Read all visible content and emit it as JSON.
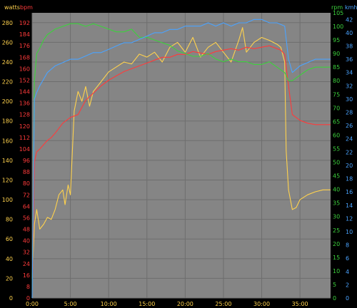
{
  "chart_data": {
    "type": "line",
    "title": "",
    "xlabel": "",
    "x_ticks": [
      "0:00",
      "5:00",
      "10:00",
      "15:00",
      "20:00",
      "25:00",
      "30:00",
      "35:00"
    ],
    "x_range_minutes": [
      0,
      39
    ],
    "grid": true,
    "axes": {
      "watts": {
        "label": "watts",
        "color": "#ffd24d",
        "range": [
          0,
          290
        ],
        "ticks": [
          0,
          20,
          40,
          60,
          80,
          100,
          120,
          140,
          160,
          180,
          200,
          220,
          240,
          260,
          280
        ]
      },
      "bpm": {
        "label": "bpm",
        "color": "#ff3b3b",
        "range": [
          0,
          199
        ],
        "ticks": [
          0,
          8,
          16,
          24,
          32,
          40,
          48,
          56,
          64,
          72,
          80,
          88,
          96,
          104,
          112,
          120,
          128,
          136,
          144,
          152,
          160,
          168,
          176,
          184,
          192
        ]
      },
      "rpm": {
        "label": "rpm",
        "color": "#3cd23c",
        "range": [
          0,
          105
        ],
        "ticks": [
          0,
          5,
          10,
          15,
          20,
          25,
          30,
          35,
          40,
          45,
          50,
          55,
          60,
          65,
          70,
          75,
          80,
          85,
          90,
          95,
          100,
          105
        ]
      },
      "kmh": {
        "label": "kmh",
        "color": "#4aa3ff",
        "range": [
          0,
          43
        ],
        "ticks": [
          0,
          2,
          4,
          6,
          8,
          10,
          12,
          14,
          16,
          18,
          20,
          22,
          24,
          26,
          28,
          30,
          32,
          34,
          36,
          38,
          40,
          42
        ]
      }
    },
    "series": [
      {
        "axis": "watts",
        "color": "#ffd24d",
        "x": [
          0,
          0.3,
          0.6,
          1,
          1.5,
          2,
          2.5,
          3,
          3.5,
          4,
          4.3,
          4.7,
          5,
          5.5,
          6,
          6.5,
          7,
          7.5,
          8,
          9,
          10,
          11,
          12,
          13,
          14,
          15,
          16,
          17,
          18,
          19,
          20,
          21,
          22,
          23,
          24,
          25,
          26,
          27,
          27.5,
          28,
          28.5,
          29,
          30,
          31,
          32,
          32.5,
          33,
          33.2,
          33.5,
          34,
          34.5,
          35,
          36,
          37,
          38,
          39
        ],
        "y": [
          20,
          75,
          90,
          70,
          75,
          82,
          80,
          90,
          105,
          110,
          95,
          115,
          105,
          190,
          210,
          200,
          215,
          195,
          210,
          220,
          230,
          235,
          240,
          238,
          248,
          245,
          250,
          240,
          255,
          260,
          250,
          265,
          245,
          255,
          260,
          250,
          240,
          262,
          275,
          250,
          255,
          260,
          265,
          262,
          258,
          255,
          240,
          150,
          110,
          90,
          92,
          100,
          105,
          108,
          110,
          110
        ]
      },
      {
        "axis": "bpm",
        "color": "#ff3b3b",
        "x": [
          0,
          0.3,
          0.6,
          1,
          1.5,
          2,
          2.5,
          3,
          4,
          5,
          6,
          7,
          8,
          9,
          10,
          11,
          12,
          13,
          14,
          15,
          16,
          17,
          18,
          19,
          20,
          21,
          22,
          23,
          24,
          25,
          26,
          27,
          28,
          29,
          30,
          31,
          32,
          32.5,
          33,
          33.5,
          34,
          35,
          36,
          37,
          38,
          39
        ],
        "y": [
          0,
          95,
          102,
          104,
          107,
          110,
          112,
          115,
          122,
          126,
          128,
          138,
          143,
          148,
          152,
          155,
          158,
          160,
          162,
          164,
          166,
          168,
          168,
          170,
          170,
          172,
          171,
          170,
          172,
          173,
          174,
          173,
          175,
          174,
          175,
          176,
          174,
          173,
          170,
          148,
          128,
          124,
          122,
          121,
          121,
          121
        ]
      },
      {
        "axis": "rpm",
        "color": "#3cd23c",
        "x": [
          0,
          0.3,
          0.6,
          1,
          1.5,
          2,
          3,
          4,
          5,
          6,
          7,
          8,
          9,
          10,
          11,
          12,
          13,
          14,
          15,
          16,
          17,
          18,
          19,
          20,
          21,
          22,
          23,
          24,
          25,
          26,
          27,
          28,
          29,
          30,
          31,
          32,
          33,
          33.5,
          34,
          35,
          36,
          37,
          38,
          39
        ],
        "y": [
          0,
          80,
          90,
          92,
          95,
          97,
          99,
          100,
          101,
          101,
          100,
          101,
          100,
          99,
          98,
          98,
          99,
          96,
          96,
          95,
          94,
          93,
          91,
          90,
          89,
          89,
          90,
          88,
          87,
          88,
          87,
          87,
          86,
          86,
          87,
          85,
          83,
          80,
          80,
          82,
          84,
          85,
          85,
          85
        ]
      },
      {
        "axis": "kmh",
        "color": "#4aa3ff",
        "x": [
          0,
          0.3,
          0.6,
          1,
          1.5,
          2,
          3,
          4,
          5,
          6,
          7,
          8,
          9,
          10,
          11,
          12,
          13,
          14,
          15,
          16,
          17,
          18,
          19,
          20,
          21,
          22,
          23,
          24,
          25,
          26,
          27,
          28,
          29,
          30,
          31,
          32,
          33,
          33.5,
          34,
          35,
          36,
          37,
          38,
          39
        ],
        "y": [
          0,
          30,
          31,
          32,
          33,
          34,
          35,
          35.5,
          36,
          36,
          36.5,
          37,
          37,
          37.5,
          38,
          38.5,
          38.5,
          39,
          39.5,
          40,
          40,
          40.5,
          40.5,
          41,
          41,
          41,
          41.5,
          41,
          41.5,
          41,
          41.5,
          41.5,
          42,
          42,
          41.5,
          41.5,
          41,
          36,
          34,
          35,
          35.5,
          36,
          36,
          36
        ]
      }
    ]
  }
}
